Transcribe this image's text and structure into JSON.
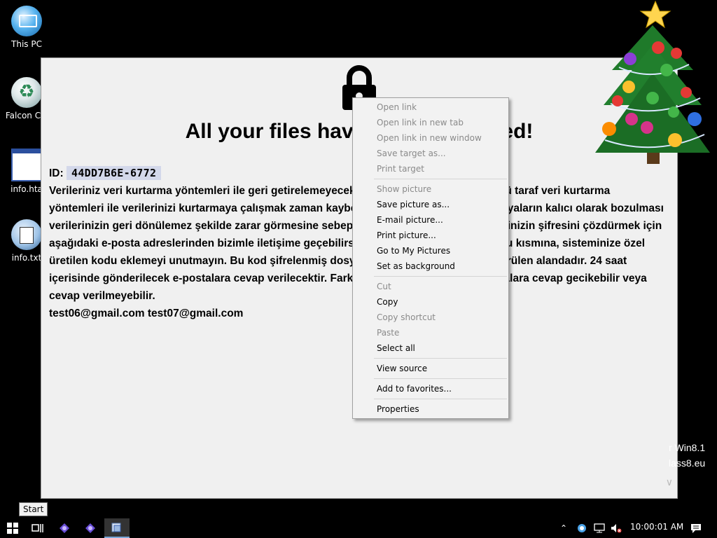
{
  "desktop": {
    "icons": [
      {
        "label": "This PC",
        "icon": "this-pc-icon"
      },
      {
        "label": "Falcon C+",
        "icon": "recycle-bin-icon"
      },
      {
        "label": "info.hta",
        "icon": "hta-file-icon"
      },
      {
        "label": "info.txt",
        "icon": "text-file-icon"
      }
    ],
    "watermark": {
      "line1": "r Win8.1",
      "line2": "lass8.eu"
    }
  },
  "ransom_window": {
    "headline": "All your files have been encrypted!",
    "id_label": "ID:",
    "id_value": "44DD7B6E-6772",
    "body": "Verileriniz veri kurtarma yöntemleri ile geri getirelemeyecek şekilde şifrelenmiştir. Üçüncü taraf veri kurtarma yöntemleri ile verilerinizi kurtarmaya çalışmak zaman kaybetmenize sebep olabilir ve dosyaların kalıcı olarak bozulması verilerinizin geri dönülemez şekilde zarar görmesine sebep olabilir. Kurcalamayın. Verilerinizin şifresini çözdürmek için aşağıdaki e-posta adreslerinden bizimle iletişime geçebilirsiniz. E-posta gönderirken konu kısmına, sisteminize özel üretilen kodu eklemeyi unutmayın. Bu kod şifrelenmiş dosyaların sonunda .id[] olarak görülen alandadır. 24 saat içerisinde gönderilecek e-postalara cevap verilecektir. Farklı saatlerde gönderilen e-postalara cevap gecikebilir veya cevap verilmeyebilir.",
    "emails": "test06@gmail.com test07@gmail.com"
  },
  "context_menu": {
    "items": [
      {
        "label": "Open link",
        "enabled": false
      },
      {
        "label": "Open link in new tab",
        "enabled": false
      },
      {
        "label": "Open link in new window",
        "enabled": false
      },
      {
        "label": "Save target as...",
        "enabled": false
      },
      {
        "label": "Print target",
        "enabled": false
      },
      {
        "label": "Show picture",
        "enabled": false
      },
      {
        "label": "Save picture as...",
        "enabled": true
      },
      {
        "label": "E-mail picture...",
        "enabled": true
      },
      {
        "label": "Print picture...",
        "enabled": true
      },
      {
        "label": "Go to My Pictures",
        "enabled": true
      },
      {
        "label": "Set as background",
        "enabled": true
      },
      {
        "label": "Cut",
        "enabled": false
      },
      {
        "label": "Copy",
        "enabled": true
      },
      {
        "label": "Copy shortcut",
        "enabled": false
      },
      {
        "label": "Paste",
        "enabled": false
      },
      {
        "label": "Select all",
        "enabled": true
      },
      {
        "label": "View source",
        "enabled": true
      },
      {
        "label": "Add to favorites...",
        "enabled": true
      },
      {
        "label": "Properties",
        "enabled": true
      }
    ]
  },
  "taskbar": {
    "start_tooltip": "Start",
    "clock": "10:00:01 AM"
  },
  "colors": {
    "desktop_bg": "#000000",
    "window_bg": "#f0f0f0",
    "id_highlight": "#d3d8ea",
    "menu_bg": "#f2f2f2",
    "disabled_text": "#8a8a8a"
  }
}
